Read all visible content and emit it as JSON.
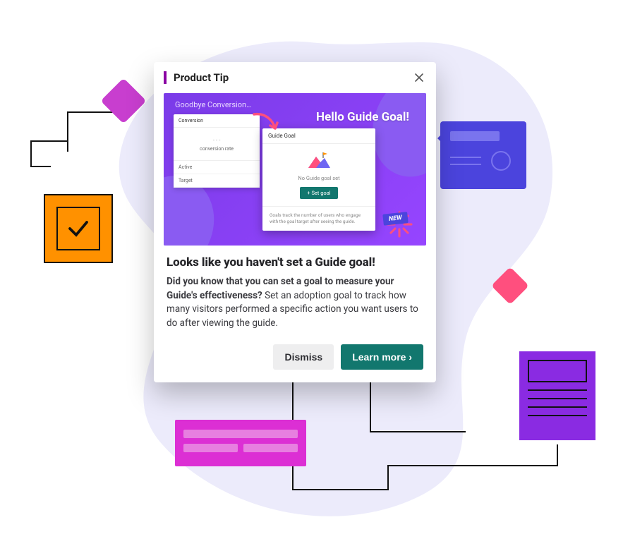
{
  "modal": {
    "header_title": "Product Tip",
    "illustration": {
      "caption_old": "Goodbye Conversion…",
      "caption_new": "Hello Guide Goal!",
      "old_card": {
        "heading": "Conversion",
        "value": "- - -",
        "value_sub": "conversion rate",
        "row1": "Active",
        "row2": "Target"
      },
      "new_card": {
        "heading": "Guide Goal",
        "no_goal_msg": "No Guide goal set",
        "set_goal_btn": "+ Set goal",
        "footer": "Goals track the number of users who engage with the goal target after seeing the guide."
      },
      "new_badge": "NEW"
    },
    "headline": "Looks like you haven't set a Guide goal!",
    "body_bold": "Did you know that you can set a goal to measure your Guide's effectiveness?",
    "body_rest": " Set an adoption goal to track how many visitors performed a specific action you want users to do after viewing the guide.",
    "actions": {
      "dismiss": "Dismiss",
      "learn_more": "Learn more ›"
    }
  }
}
